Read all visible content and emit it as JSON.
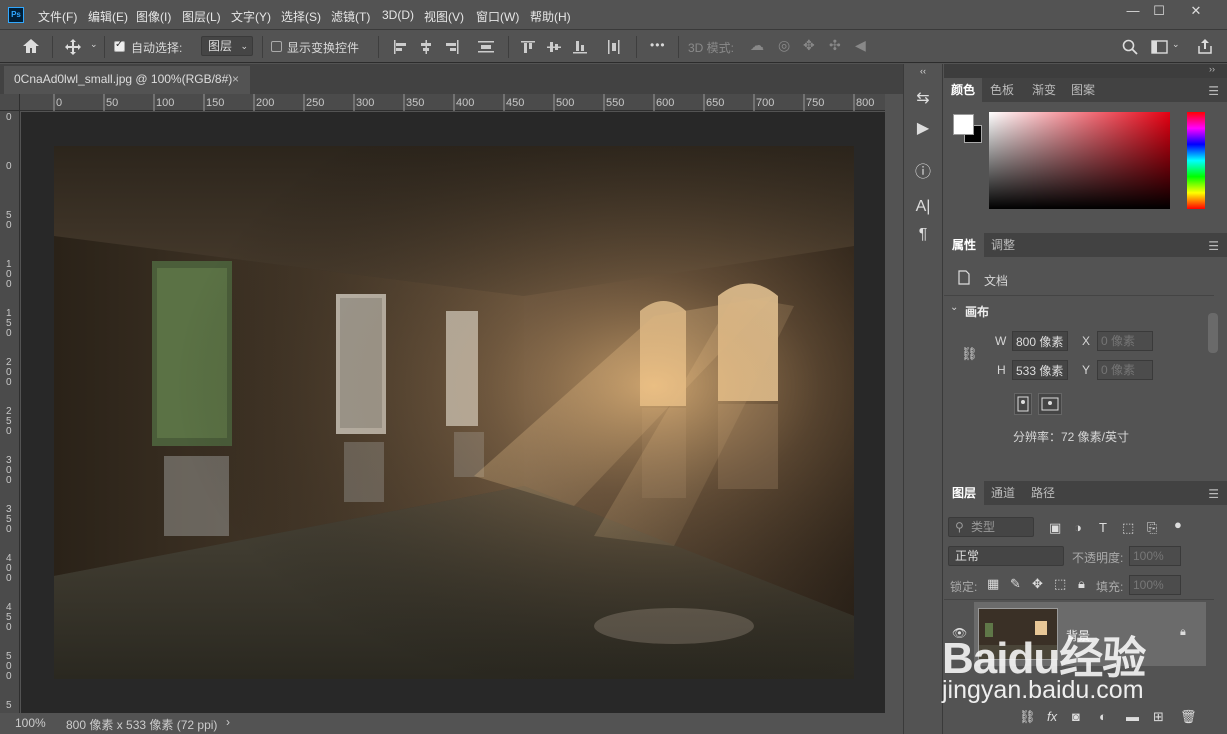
{
  "app": {
    "logo": "Ps"
  },
  "menu": [
    "文件(F)",
    "编辑(E)",
    "图像(I)",
    "图层(L)",
    "文字(Y)",
    "选择(S)",
    "滤镜(T)",
    "3D(D)",
    "视图(V)",
    "窗口(W)",
    "帮助(H)"
  ],
  "window_controls": {
    "minimize": "—",
    "maximize": "☐",
    "close": "✕"
  },
  "options": {
    "auto_select_label": "自动选择:",
    "auto_select_checked": true,
    "target_value": "图层",
    "show_transform_label": "显示变换控件",
    "show_transform_checked": false,
    "more": "•••",
    "mode_3d_label": "3D 模式:"
  },
  "document_tab": {
    "title": "0CnaAd0lwl_small.jpg @ 100%(RGB/8#)",
    "close": "×"
  },
  "ruler": {
    "h_ticks": [
      "0",
      "50",
      "100",
      "150",
      "200",
      "250",
      "300",
      "350",
      "400",
      "450",
      "500",
      "550",
      "600",
      "650",
      "700",
      "750",
      "800"
    ],
    "v_ticks": [
      "0",
      "0",
      "5\n0",
      "1\n0\n0",
      "1\n5\n0",
      "2\n0\n0",
      "2\n5\n0",
      "3\n0\n0",
      "3\n5\n0",
      "4\n0\n0",
      "4\n5\n0",
      "5\n0\n0",
      "5"
    ]
  },
  "status": {
    "zoom": "100%",
    "info": "800 像素 x 533 像素 (72 ppi)",
    "arrow": "›"
  },
  "color_panel": {
    "tabs": [
      "颜色",
      "色板",
      "渐变",
      "图案"
    ],
    "active_tab": "颜色",
    "foreground": "#ffffff",
    "background": "#000000",
    "hue": "#e60012"
  },
  "properties_panel": {
    "tabs": [
      "属性",
      "调整"
    ],
    "active_tab": "属性",
    "doc_label": "文档",
    "section_title": "画布",
    "width_label": "W",
    "width_value": "800 像素",
    "height_label": "H",
    "height_value": "533 像素",
    "x_label": "X",
    "x_placeholder": "0 像素",
    "y_label": "Y",
    "y_placeholder": "0 像素",
    "resolution": "分辨率：72 像素/英寸"
  },
  "layers_panel": {
    "tabs": [
      "图层",
      "通道",
      "路径"
    ],
    "active_tab": "图层",
    "filter_placeholder": "类型",
    "blend_mode": "正常",
    "opacity_label": "不透明度:",
    "opacity_value": "100%",
    "lock_label": "锁定:",
    "fill_label": "填充:",
    "fill_value": "100%",
    "layers": [
      {
        "name": "背景",
        "visible": true,
        "locked": true
      }
    ]
  },
  "watermark": {
    "brand": "Baidu经验",
    "url": "jingyan.baidu.com"
  }
}
